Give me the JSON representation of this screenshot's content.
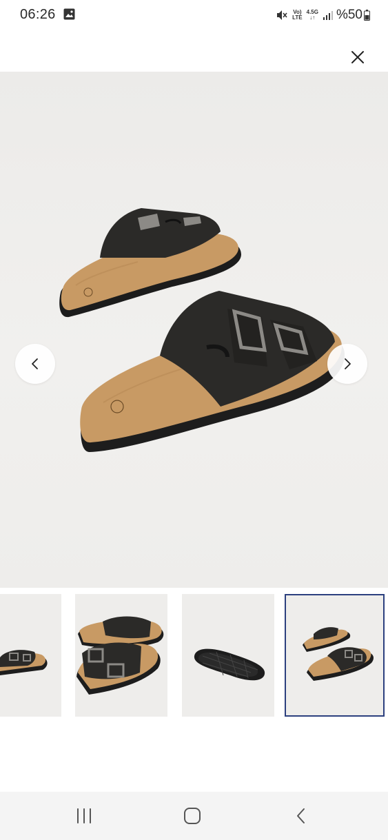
{
  "status_bar": {
    "time": "06:26",
    "volte_line1": "Vo)",
    "volte_line2": "LTE",
    "network_line1": "4.5G",
    "network_line2": "↓↑",
    "battery": "%50",
    "icons": [
      "gallery-icon",
      "mute-icon",
      "signal-icon",
      "battery-icon"
    ]
  },
  "viewer": {
    "close_icon": "close-icon",
    "prev_icon": "chevron-left-icon",
    "next_icon": "chevron-right-icon",
    "thumbnails": [
      {
        "name": "thumbnail-1",
        "selected": false
      },
      {
        "name": "thumbnail-2",
        "selected": false
      },
      {
        "name": "thumbnail-3",
        "selected": false
      },
      {
        "name": "thumbnail-4",
        "selected": true
      }
    ],
    "selected_border_color": "#2b3f7e"
  },
  "nav_bar": {
    "icons": [
      "recents-icon",
      "home-icon",
      "back-icon"
    ]
  },
  "colors": {
    "footbed": "#c89a64",
    "strap": "#2b2a28",
    "sole": "#1d1d1d",
    "buckle": "#8c8a86"
  }
}
